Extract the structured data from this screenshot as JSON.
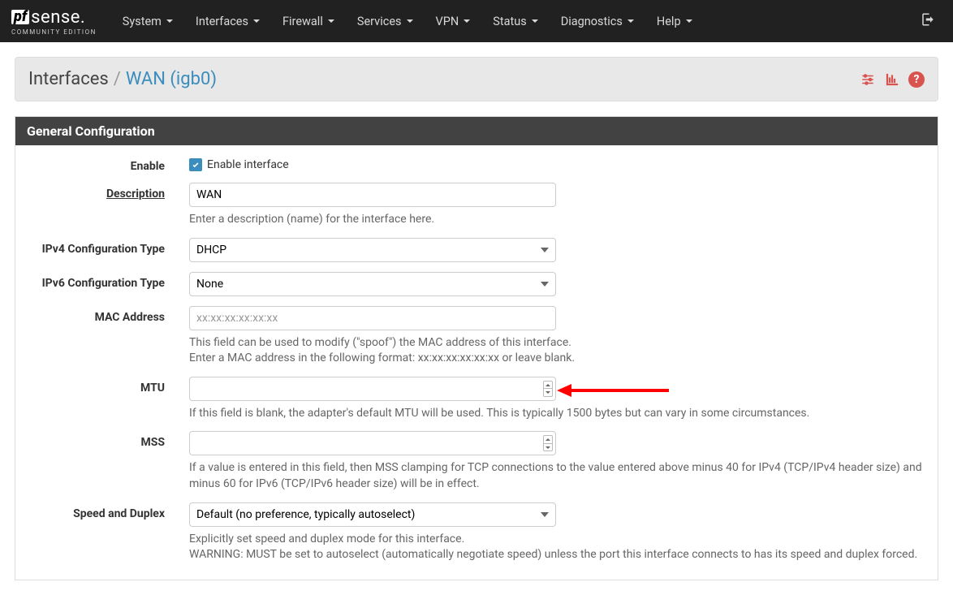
{
  "brand": {
    "pf": "pf",
    "sense": "sense",
    "dot": ".",
    "sub": "COMMUNITY EDITION"
  },
  "nav": {
    "items": [
      "System",
      "Interfaces",
      "Firewall",
      "Services",
      "VPN",
      "Status",
      "Diagnostics",
      "Help"
    ]
  },
  "breadcrumb": {
    "first": "Interfaces",
    "sep": "/",
    "current": "WAN (igb0)"
  },
  "panel": {
    "title": "General Configuration"
  },
  "form": {
    "enable": {
      "label": "Enable",
      "checkbox_label": "Enable interface",
      "checked": true
    },
    "description": {
      "label": "Description",
      "value": "WAN",
      "help": "Enter a description (name) for the interface here."
    },
    "ipv4": {
      "label": "IPv4 Configuration Type",
      "value": "DHCP"
    },
    "ipv6": {
      "label": "IPv6 Configuration Type",
      "value": "None"
    },
    "mac": {
      "label": "MAC Address",
      "placeholder": "xx:xx:xx:xx:xx:xx",
      "value": "",
      "help": "This field can be used to modify (\"spoof\") the MAC address of this interface.\nEnter a MAC address in the following format: xx:xx:xx:xx:xx:xx or leave blank."
    },
    "mtu": {
      "label": "MTU",
      "value": "",
      "help": "If this field is blank, the adapter's default MTU will be used. This is typically 1500 bytes but can vary in some circumstances."
    },
    "mss": {
      "label": "MSS",
      "value": "",
      "help": "If a value is entered in this field, then MSS clamping for TCP connections to the value entered above minus 40 for IPv4 (TCP/IPv4 header size) and minus 60 for IPv6 (TCP/IPv6 header size) will be in effect."
    },
    "speed": {
      "label": "Speed and Duplex",
      "value": "Default (no preference, typically autoselect)",
      "help": "Explicitly set speed and duplex mode for this interface.\nWARNING: MUST be set to autoselect (automatically negotiate speed) unless the port this interface connects to has its speed and duplex forced."
    }
  }
}
